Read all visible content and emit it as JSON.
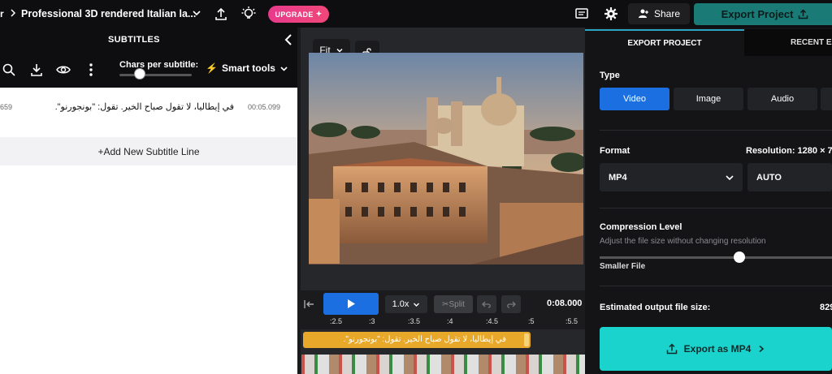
{
  "topbar": {
    "crumb": "r",
    "title": "Professional 3D rendered Italian la...",
    "upgrade": "UPGRADE",
    "share": "Share",
    "export_project": "Export Project"
  },
  "left_panel": {
    "header": "SUBTITLES",
    "chars_per_subtitle": "Chars per subtitle:",
    "smart_tools": "Smart tools",
    "subtitle_index": "659",
    "subtitle_text": "في إيطاليا، لا تقول صباح الخير. تقول: \"بونجورنو\".",
    "subtitle_time": "00:05.099",
    "add_line": "+Add New Subtitle Line"
  },
  "center": {
    "fit": "Fit",
    "speed": "1.0x",
    "split": "Split",
    "timecode": "0:08.000",
    "ruler": [
      ":2.5",
      ":3",
      ":3.5",
      ":4",
      ":4.5",
      ":5",
      ":5.5"
    ],
    "track_text": "في إيطاليا، لا تقول صباح الخير. تقول: \"بونجورنو\"."
  },
  "right_panel": {
    "tab_export": "EXPORT PROJECT",
    "tab_recent": "RECENT EX",
    "type_label": "Type",
    "types": [
      "Video",
      "Image",
      "Audio"
    ],
    "format_label": "Format",
    "resolution_label": "Resolution: 1280 × 7",
    "format_value": "MP4",
    "resolution_value": "AUTO",
    "compression_label": "Compression Level",
    "compression_sub": "Adjust the file size without changing resolution",
    "smaller_file": "Smaller File",
    "estimated_label": "Estimated output file size:",
    "estimated_value": "829",
    "export_button": "Export as MP4",
    "compression_level": 0.6
  },
  "colors": {
    "accent_blue": "#1c6fe0",
    "export_teal": "#1ad3cc",
    "upgrade_pink": "#e83a8b"
  }
}
